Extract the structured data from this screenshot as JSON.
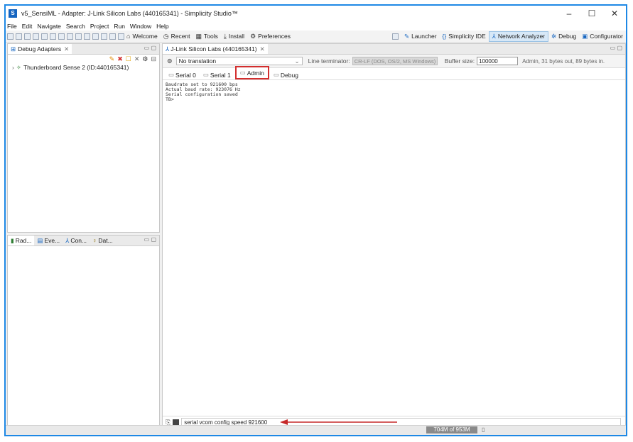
{
  "window": {
    "title": "v5_SensiML - Adapter: J-Link Silicon Labs (440165341) - Simplicity Studio™",
    "controls": [
      "–",
      "☐",
      "✕"
    ]
  },
  "menubar": [
    "File",
    "Edit",
    "Navigate",
    "Search",
    "Project",
    "Run",
    "Window",
    "Help"
  ],
  "toolbar": {
    "links": [
      {
        "icon": "home-icon",
        "glyph": "⌂",
        "label": "Welcome"
      },
      {
        "icon": "clock-icon",
        "glyph": "◷",
        "label": "Recent"
      },
      {
        "icon": "grid-icon",
        "glyph": "▦",
        "label": "Tools"
      },
      {
        "icon": "install-icon",
        "glyph": "⤓",
        "label": "Install"
      },
      {
        "icon": "gear-icon",
        "glyph": "⚙",
        "label": "Preferences"
      }
    ],
    "perspectives": [
      {
        "label": "Launcher",
        "glyph": "✎",
        "active": false
      },
      {
        "label": "Simplicity IDE",
        "glyph": "{}",
        "active": false
      },
      {
        "label": "Network Analyzer",
        "glyph": "⅄",
        "active": true
      },
      {
        "label": "Debug",
        "glyph": "✲",
        "active": false
      },
      {
        "label": "Configurator",
        "glyph": "▣",
        "active": false
      }
    ]
  },
  "debug_adapters": {
    "tab_label": "Debug Adapters",
    "device": "Thunderboard Sense 2 (ID:440165341)"
  },
  "bottom_left_tabs": [
    "Rad...",
    "Eve...",
    "Con...",
    "Dat..."
  ],
  "console": {
    "tab_label": "J-Link Silicon Labs (440165341)",
    "translation": "No translation",
    "line_terminator_label": "Line terminator:",
    "line_terminator_value": "CR-LF (DOS, OS/2, MS Windows)",
    "buffer_label": "Buffer size:",
    "buffer_value": "100000",
    "status": "Admin, 31 bytes out, 89 bytes in.",
    "tabs": [
      "Serial 0",
      "Serial 1",
      "Admin",
      "Debug"
    ],
    "selected_tab": "Admin",
    "output_lines": [
      "Baudrate set to 921600 bps",
      "Actual baud rate: 923076 Hz",
      "Serial configuration saved",
      "TB>"
    ],
    "command": "serial vcom config speed 921600"
  },
  "status_bar": {
    "heap": "704M of 953M"
  },
  "colors": {
    "frame": "#1e88e5",
    "highlight": "#d32f2f",
    "arrow": "#c62828"
  }
}
